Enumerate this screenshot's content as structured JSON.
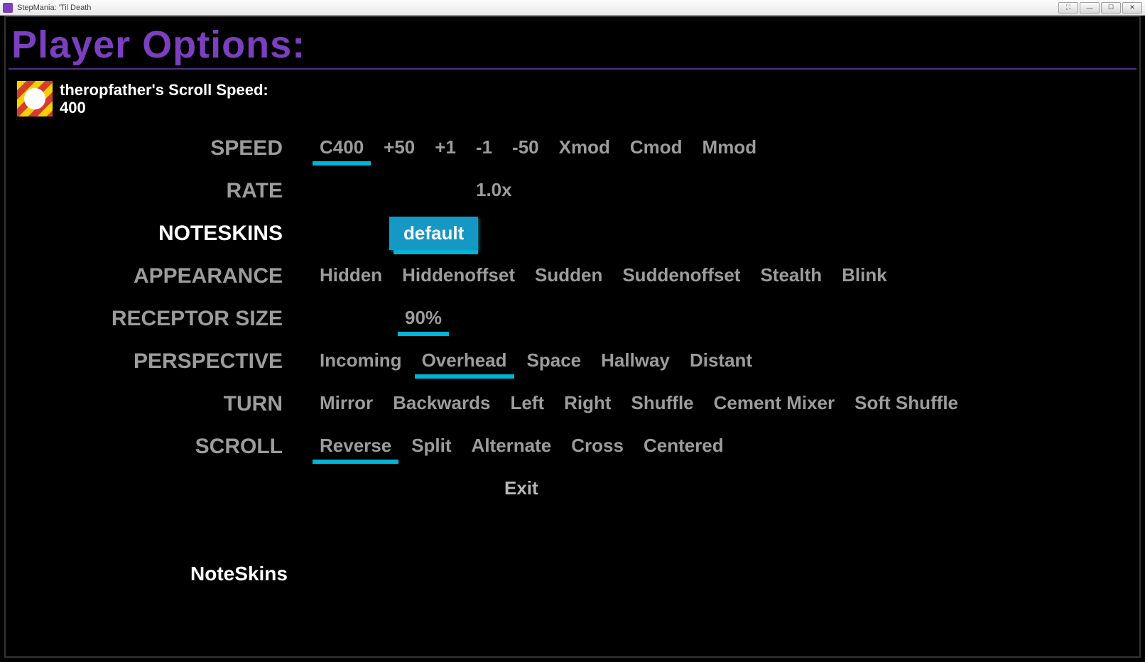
{
  "window": {
    "title": "StepMania: 'Til Death"
  },
  "page": {
    "title": "Player Options:"
  },
  "player": {
    "scroll_label": "theropfather's Scroll Speed:",
    "scroll_value": "400"
  },
  "rows": {
    "speed": {
      "label": "SPEED",
      "items": [
        "C400",
        "+50",
        "+1",
        "-1",
        "-50",
        "Xmod",
        "Cmod",
        "Mmod"
      ],
      "selected": 0
    },
    "rate": {
      "label": "RATE",
      "items": [
        "1.0x"
      ],
      "selected": -1
    },
    "noteskins": {
      "label": "NOTESKINS",
      "items": [
        "default"
      ],
      "selected": 0
    },
    "appearance": {
      "label": "APPEARANCE",
      "items": [
        "Hidden",
        "Hiddenoffset",
        "Sudden",
        "Suddenoffset",
        "Stealth",
        "Blink"
      ],
      "selected": -1
    },
    "receptor": {
      "label": "RECEPTOR SIZE",
      "items": [
        "90%"
      ],
      "selected": 0
    },
    "perspective": {
      "label": "PERSPECTIVE",
      "items": [
        "Incoming",
        "Overhead",
        "Space",
        "Hallway",
        "Distant"
      ],
      "selected": 1
    },
    "turn": {
      "label": "TURN",
      "items": [
        "Mirror",
        "Backwards",
        "Left",
        "Right",
        "Shuffle",
        "Cement Mixer",
        "Soft Shuffle"
      ],
      "selected": -1
    },
    "scroll": {
      "label": "SCROLL",
      "items": [
        "Reverse",
        "Split",
        "Alternate",
        "Cross",
        "Centered"
      ],
      "selected": 0
    },
    "exit": {
      "label": "",
      "items": [
        "Exit"
      ]
    }
  },
  "active_row": "noteskins",
  "hint": "NoteSkins",
  "colors": {
    "accent": "#7B3FBF",
    "highlight": "#00B4D8"
  }
}
